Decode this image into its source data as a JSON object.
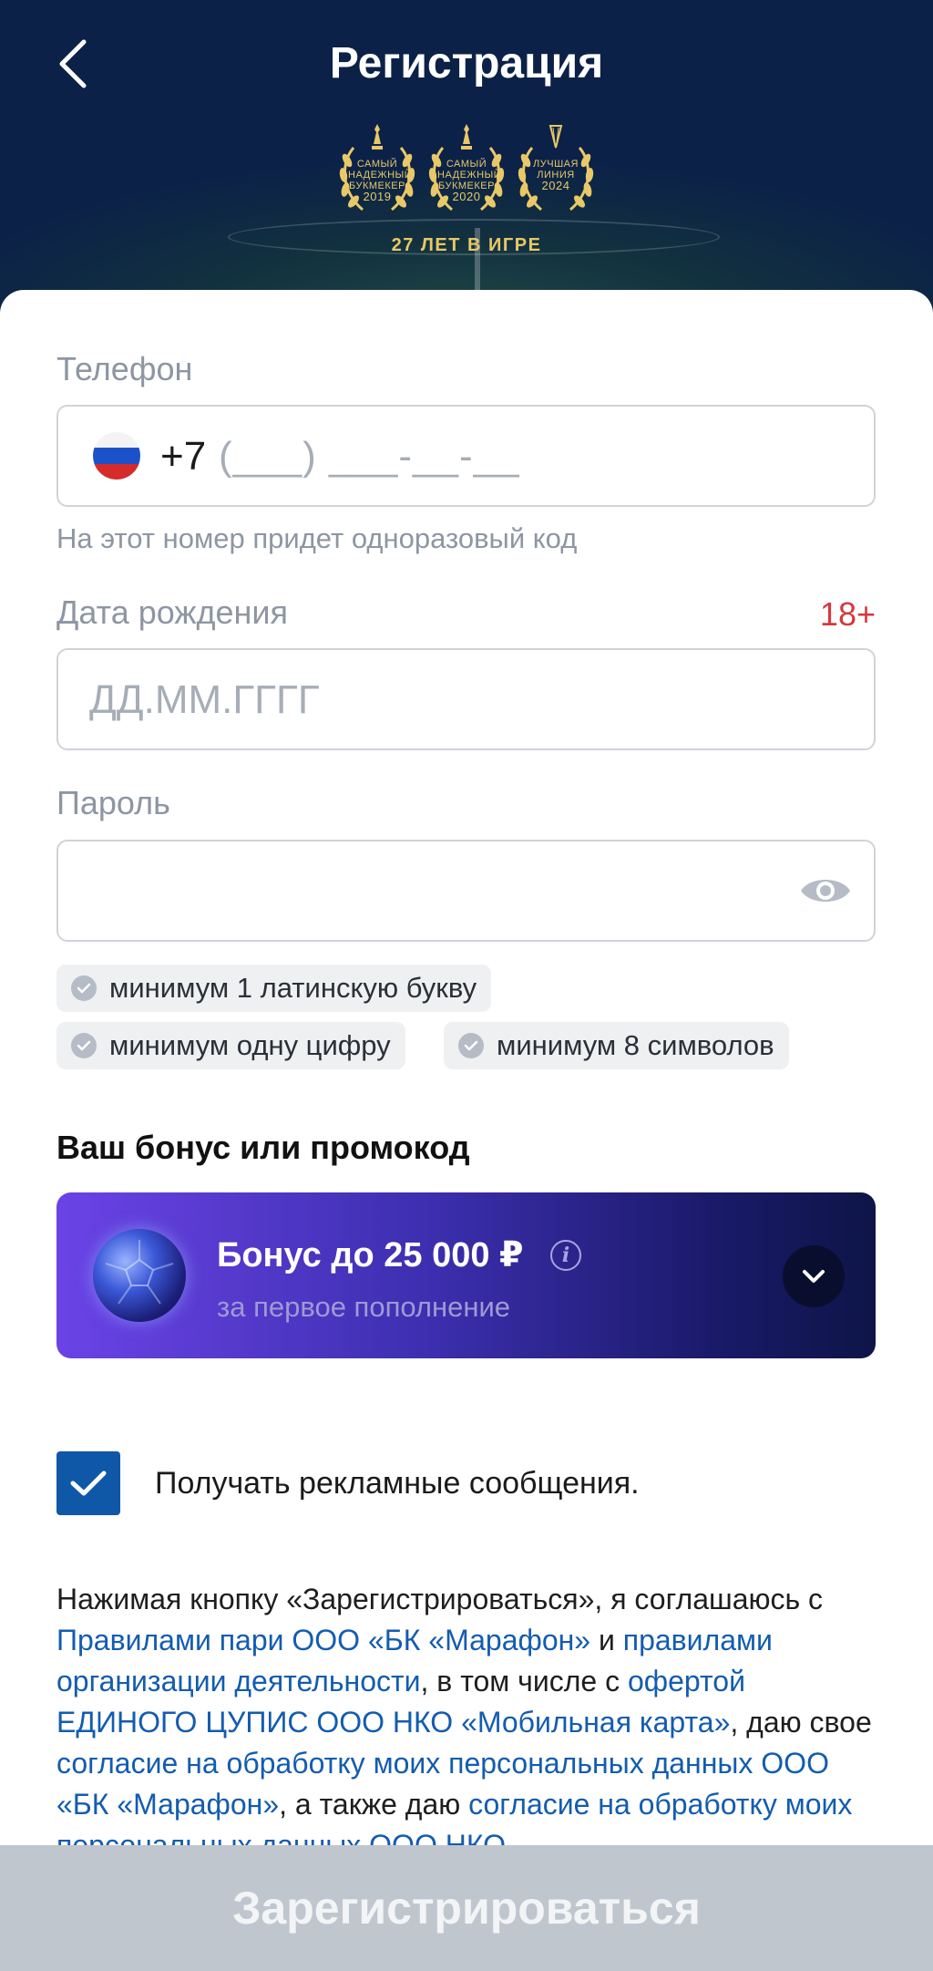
{
  "header": {
    "title": "Регистрация",
    "awards": [
      {
        "line1": "Самый",
        "line2": "надежный",
        "line3": "букмекер",
        "year": "2019"
      },
      {
        "line1": "Самый",
        "line2": "надежный",
        "line3": "букмекер",
        "year": "2020"
      },
      {
        "line1": "Лучшая",
        "line2": "линия",
        "line3": "",
        "year": "2024"
      }
    ],
    "slogan": "27 ЛЕТ В ИГРЕ"
  },
  "form": {
    "phone": {
      "label": "Телефон",
      "prefix": "+7",
      "mask": "(___) ___-__-__",
      "hint": "На этот номер придет одноразовый код"
    },
    "birthdate": {
      "label": "Дата рождения",
      "age_badge": "18+",
      "placeholder": "ДД.ММ.ГГГГ"
    },
    "password": {
      "label": "Пароль",
      "requirements": [
        "минимум 1 латинскую букву",
        "минимум одну цифру",
        "минимум 8 символов"
      ]
    }
  },
  "bonus": {
    "section_title": "Ваш бонус или промокод",
    "title": "Бонус до 25 000 ₽",
    "subtitle": "за первое пополнение"
  },
  "ads_opt_in": {
    "checked": true,
    "label": "Получать рекламные сообщения."
  },
  "legal": {
    "t1": "Нажимая кнопку «Зарегистрироваться», я соглашаюсь с ",
    "l1": "Правилами пари ООО «БК «Марафон»",
    "t2": " и ",
    "l2": "правилами организации деятельности",
    "t3": ", в том числе с ",
    "l3": "офертой ЕДИНОГО ЦУПИС ООО НКО «Мобильная карта»",
    "t4": ", даю свое ",
    "l4": "согласие на обработку моих персональных данных ООО «БК «Марафон»",
    "t5": ", а также даю ",
    "l5": "согласие на обработку моих персональных данных ООО НКО"
  },
  "footer": {
    "register_label": "Зарегистрироваться"
  },
  "colors": {
    "header_bg": "#0d2650",
    "gold": "#e9c867",
    "link": "#135cb0",
    "error_red": "#d6383d",
    "checkbox": "#0f58a8",
    "button_disabled": "#c0c6ce"
  }
}
